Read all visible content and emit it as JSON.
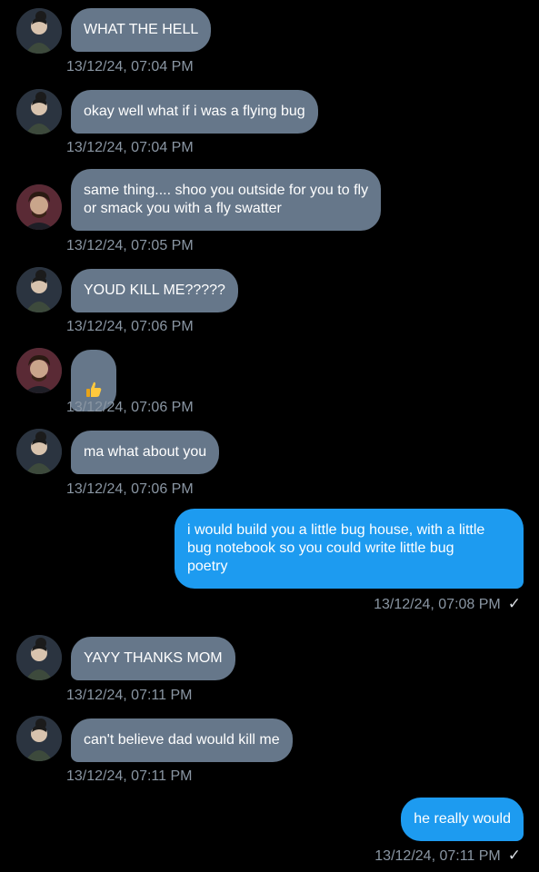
{
  "messages": [
    {
      "sender": "them",
      "avatar": "avatar-bun-girl",
      "text": "WHAT THE HELL",
      "time": "13/12/24, 07:04 PM"
    },
    {
      "sender": "them",
      "avatar": "avatar-bun-girl",
      "text": "okay well what if i was a flying bug",
      "time": "13/12/24, 07:04 PM"
    },
    {
      "sender": "them",
      "avatar": "avatar-curly-man",
      "text": "same thing.... shoo you outside for you to fly\nor smack you with a fly swatter",
      "time": "13/12/24, 07:05 PM"
    },
    {
      "sender": "them",
      "avatar": "avatar-bun-girl",
      "text": "YOUD KILL ME?????",
      "time": "13/12/24, 07:06 PM"
    },
    {
      "sender": "them",
      "avatar": "avatar-curly-man",
      "text": "",
      "emoji": "thumbs-up-icon",
      "time": "13/12/24, 07:06 PM"
    },
    {
      "sender": "them",
      "avatar": "avatar-bun-girl",
      "text": "ma what about you",
      "time": "13/12/24, 07:06 PM"
    },
    {
      "sender": "me",
      "text": "i would build you a little bug house, with a little\nbug notebook so you could write little bug\npoetry",
      "time": "13/12/24, 07:08 PM",
      "status_icon": "check-icon"
    },
    {
      "sender": "them",
      "avatar": "avatar-bun-girl",
      "text": "YAYY THANKS MOM",
      "time": "13/12/24, 07:11 PM"
    },
    {
      "sender": "them",
      "avatar": "avatar-bun-girl",
      "text": "can't believe dad would kill me",
      "time": "13/12/24, 07:11 PM"
    },
    {
      "sender": "me",
      "text": "he really would",
      "time": "13/12/24, 07:11 PM",
      "status_icon": "check-icon"
    }
  ],
  "check_glyph": "✓",
  "colors": {
    "background": "#000000",
    "incoming_bubble": "#66778a",
    "outgoing_bubble": "#1d9bf0",
    "timestamp": "#8a96a3"
  }
}
